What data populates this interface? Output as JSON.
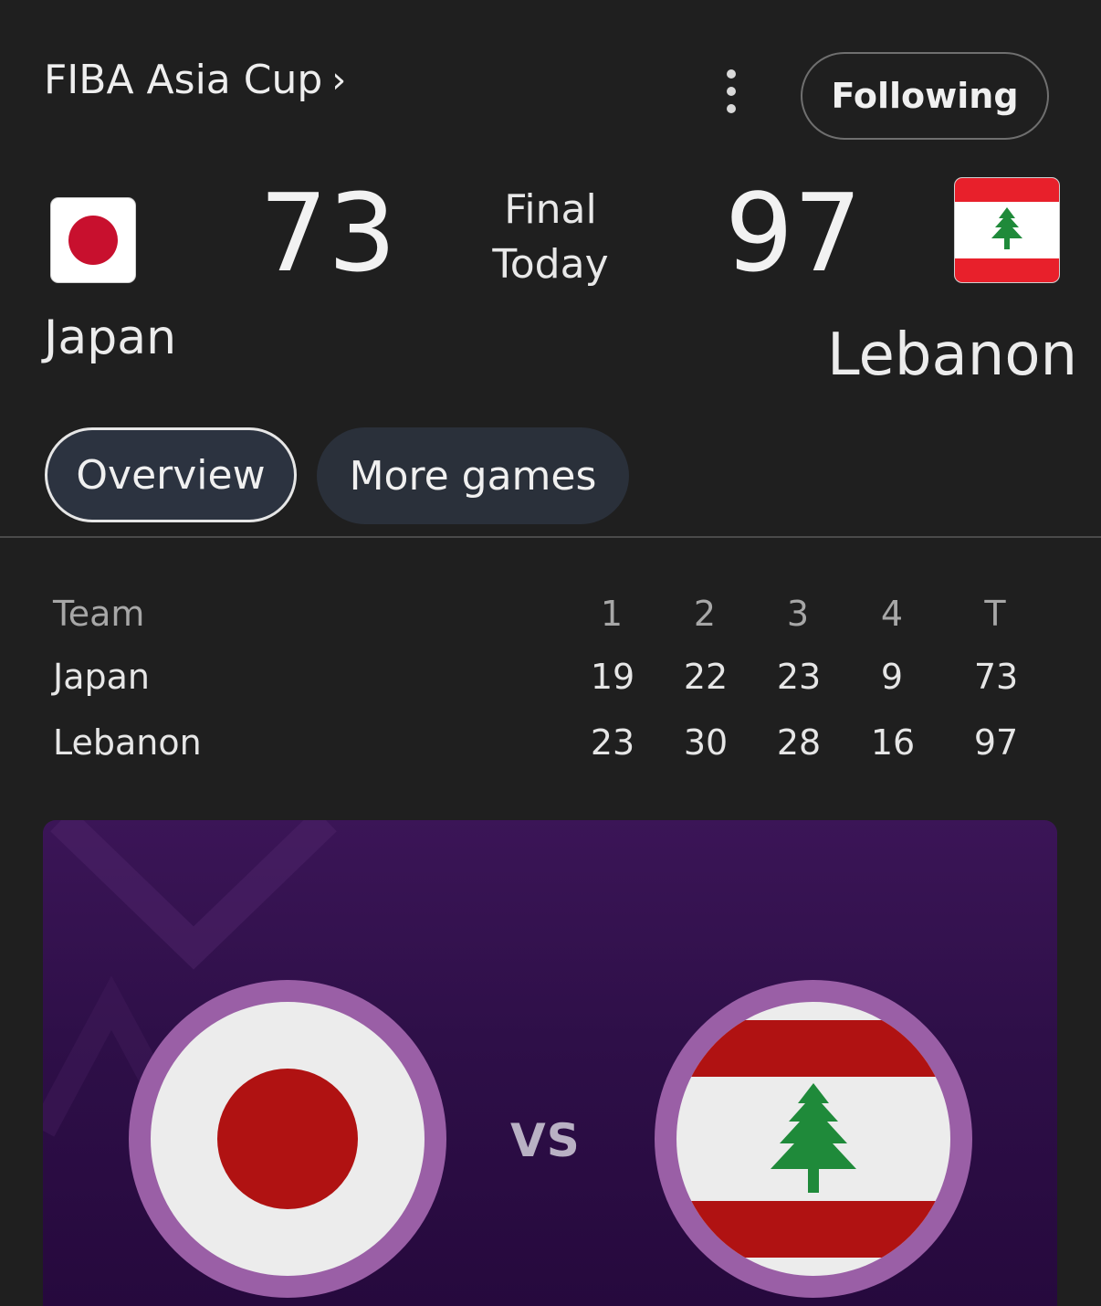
{
  "header": {
    "league": "FIBA Asia Cup",
    "league_chevron": "›",
    "menu_icon": "more-vert-icon",
    "follow_label": "Following"
  },
  "match": {
    "status": "Final",
    "date": "Today",
    "home": {
      "name": "Japan",
      "score": "73",
      "flag": "japan-flag-icon"
    },
    "away": {
      "name": "Lebanon",
      "score": "97",
      "flag": "lebanon-flag-icon"
    }
  },
  "tabs": [
    {
      "label": "Overview",
      "selected": true
    },
    {
      "label": "More games",
      "selected": false
    }
  ],
  "boxscore": {
    "headers": [
      "Team",
      "1",
      "2",
      "3",
      "4",
      "T"
    ],
    "rows": [
      {
        "team": "Japan",
        "q": [
          "19",
          "22",
          "23",
          "9"
        ],
        "total": "73"
      },
      {
        "team": "Lebanon",
        "q": [
          "23",
          "30",
          "28",
          "16"
        ],
        "total": "97"
      }
    ]
  },
  "banner": {
    "vs": "VS"
  },
  "colors": {
    "background": "#1f1f1f",
    "japan_red": "#c8102e",
    "lebanon_red": "#e8202b",
    "cedar_green": "#1f8a3a",
    "banner_purple": "#2e0f48"
  }
}
